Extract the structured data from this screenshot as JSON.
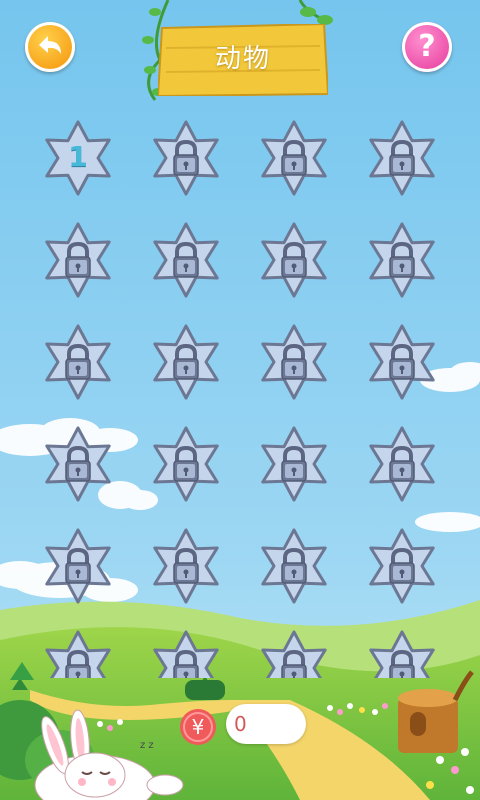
{
  "header": {
    "title": "动物",
    "help_symbol": "?"
  },
  "levels": [
    {
      "label": "1",
      "locked": false
    },
    {
      "label": "",
      "locked": true
    },
    {
      "label": "",
      "locked": true
    },
    {
      "label": "",
      "locked": true
    },
    {
      "label": "",
      "locked": true
    },
    {
      "label": "",
      "locked": true
    },
    {
      "label": "",
      "locked": true
    },
    {
      "label": "",
      "locked": true
    },
    {
      "label": "",
      "locked": true
    },
    {
      "label": "",
      "locked": true
    },
    {
      "label": "",
      "locked": true
    },
    {
      "label": "",
      "locked": true
    },
    {
      "label": "",
      "locked": true
    },
    {
      "label": "",
      "locked": true
    },
    {
      "label": "",
      "locked": true
    },
    {
      "label": "",
      "locked": true
    },
    {
      "label": "",
      "locked": true
    },
    {
      "label": "",
      "locked": true
    },
    {
      "label": "",
      "locked": true
    },
    {
      "label": "",
      "locked": true
    },
    {
      "label": "",
      "locked": true
    },
    {
      "label": "",
      "locked": true
    },
    {
      "label": "",
      "locked": true
    },
    {
      "label": "",
      "locked": true
    }
  ],
  "coins": {
    "symbol": "¥",
    "count": "0"
  },
  "colors": {
    "sky": "#7dc8ee",
    "flower_fill": "#c5d6ec",
    "flower_stroke": "#6c7794",
    "board": "#f2c83a",
    "back_button": "#f7a21a",
    "help_button": "#ec4fa8",
    "coin": "#f05a5a"
  },
  "icons": {
    "back": "back-arrow-icon",
    "help": "question-mark-icon",
    "lock": "padlock-icon",
    "coin": "yuan-coin-icon"
  }
}
